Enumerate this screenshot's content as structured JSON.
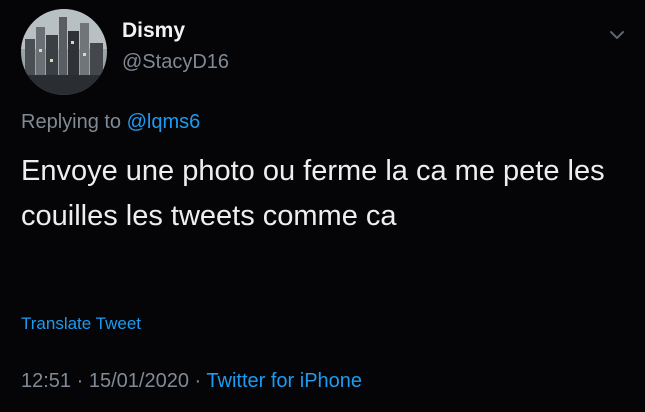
{
  "user": {
    "display_name": "Dismy",
    "handle": "@StacyD16",
    "avatar_icon": "city-skyline-avatar"
  },
  "menu_icon": "chevron-down-icon",
  "reply": {
    "prefix": "Replying to",
    "mention": "@lqms6"
  },
  "tweet": {
    "text": "Envoye une photo ou ferme la ca me pete les couilles les tweets comme ca"
  },
  "translate_label": "Translate Tweet",
  "meta": {
    "time": "12:51",
    "separator": "·",
    "date": "15/01/2020",
    "source": "Twitter for iPhone"
  },
  "colors": {
    "background": "#050507",
    "text": "#eeeeee",
    "secondary": "#7f8a96",
    "accent": "#1d9bf0"
  }
}
